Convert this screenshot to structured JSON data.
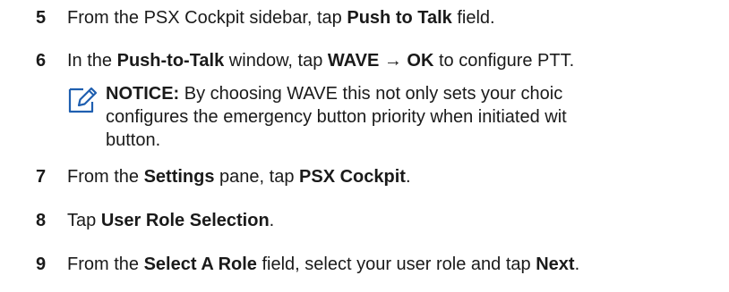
{
  "steps": [
    {
      "num": "5",
      "parts": [
        {
          "t": "From the PSX Cockpit sidebar, tap ",
          "b": false
        },
        {
          "t": "Push to Talk",
          "b": true
        },
        {
          "t": " field.",
          "b": false
        }
      ]
    },
    {
      "num": "6",
      "parts": [
        {
          "t": "In the ",
          "b": false
        },
        {
          "t": "Push-to-Talk",
          "b": true
        },
        {
          "t": " window, tap ",
          "b": false
        },
        {
          "t": "WAVE",
          "b": true
        },
        {
          "t": " → ",
          "b": false
        },
        {
          "t": "OK",
          "b": true
        },
        {
          "t": " to configure PTT.",
          "b": false
        }
      ]
    },
    {
      "num": "7",
      "parts": [
        {
          "t": "From the ",
          "b": false
        },
        {
          "t": "Settings",
          "b": true
        },
        {
          "t": " pane, tap ",
          "b": false
        },
        {
          "t": "PSX Cockpit",
          "b": true
        },
        {
          "t": ".",
          "b": false
        }
      ]
    },
    {
      "num": "8",
      "parts": [
        {
          "t": "Tap ",
          "b": false
        },
        {
          "t": "User Role Selection",
          "b": true
        },
        {
          "t": ".",
          "b": false
        }
      ]
    },
    {
      "num": "9",
      "parts": [
        {
          "t": "From the ",
          "b": false
        },
        {
          "t": "Select A Role",
          "b": true
        },
        {
          "t": " field, select your user role and tap ",
          "b": false
        },
        {
          "t": "Next",
          "b": true
        },
        {
          "t": ".",
          "b": false
        }
      ]
    }
  ],
  "notice": {
    "label": "NOTICE:",
    "line1": " By choosing WAVE this not only sets your choic",
    "line2": "configures the emergency button priority when initiated wit",
    "line3": "button.",
    "icon": "notice-pencil-icon",
    "icon_color": "#1f5fb0"
  }
}
